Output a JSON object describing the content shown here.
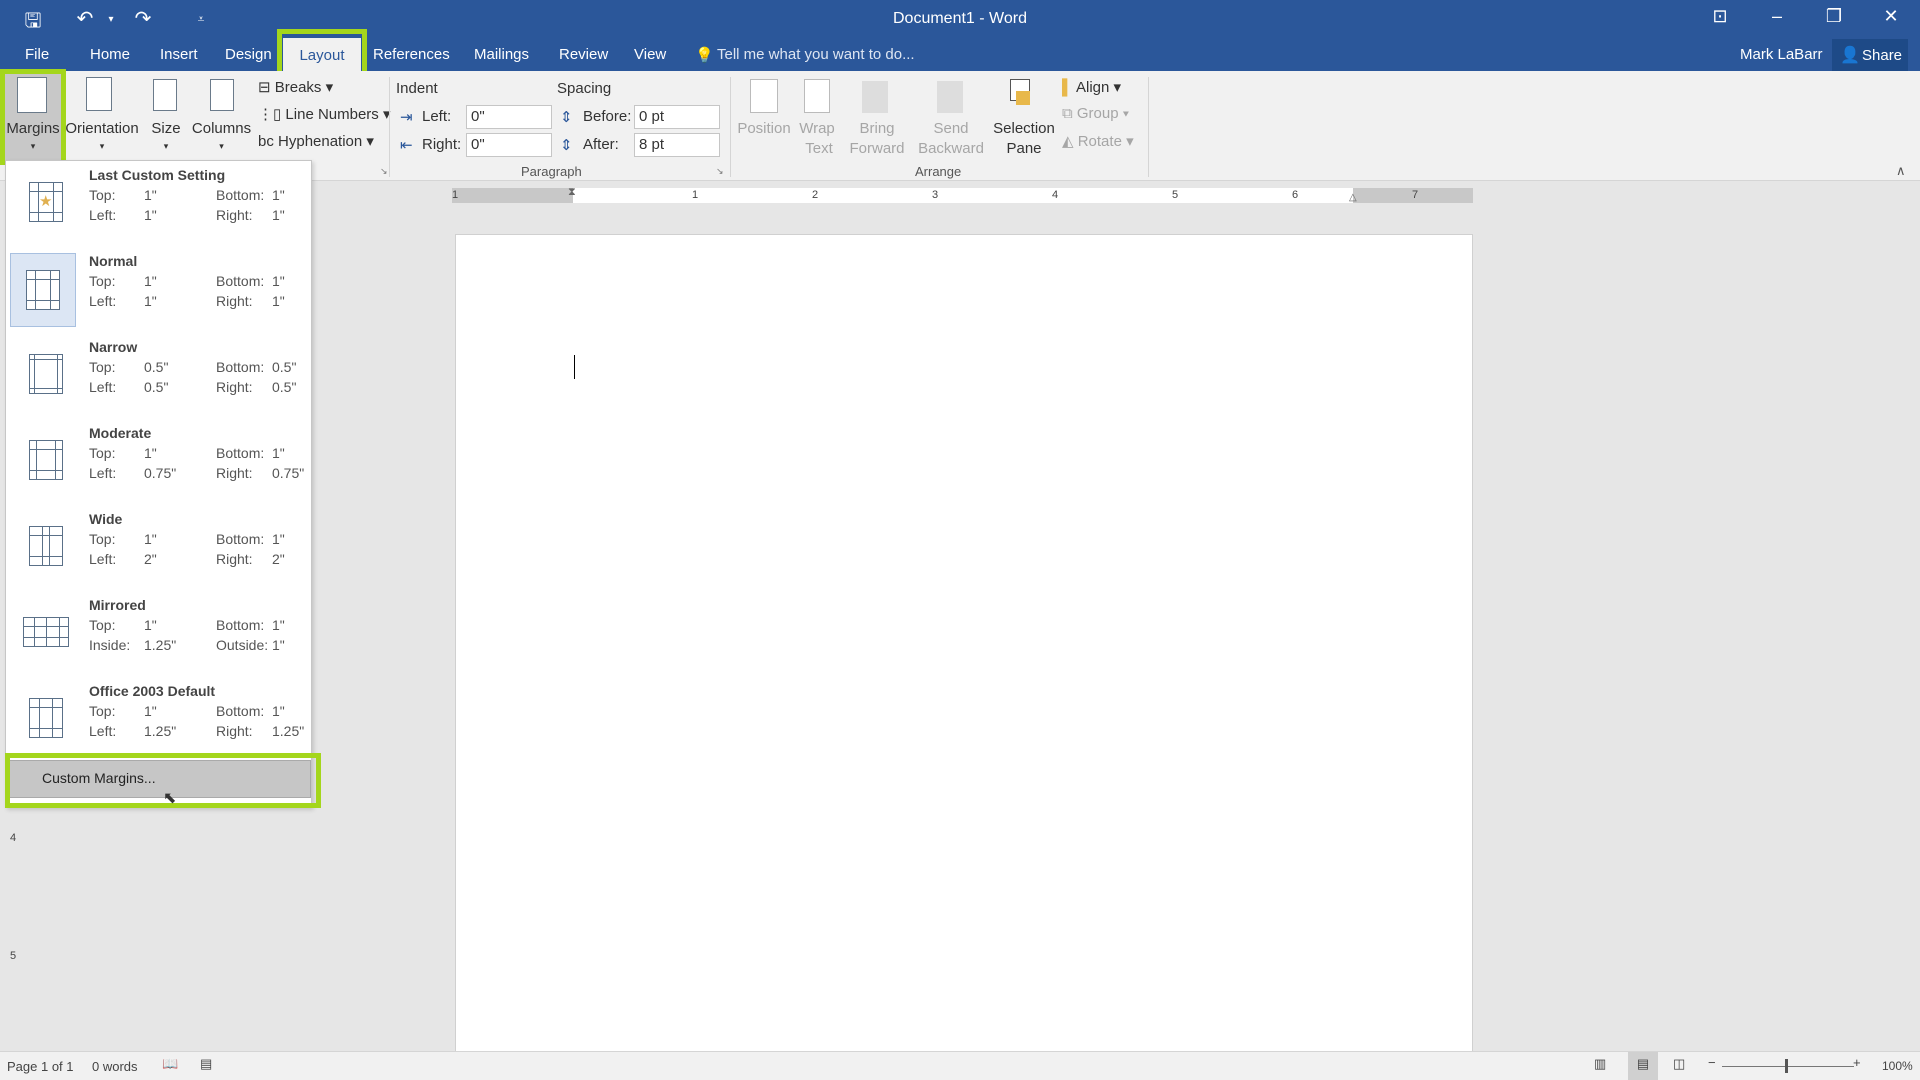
{
  "window": {
    "title": "Document1 - Word",
    "user": "Mark LaBarr",
    "share": "Share"
  },
  "tabs": [
    "File",
    "Home",
    "Insert",
    "Design",
    "Layout",
    "References",
    "Mailings",
    "Review",
    "View"
  ],
  "tell_me": "Tell me what you want to do...",
  "ribbon": {
    "page_setup": {
      "margins": "Margins",
      "orientation": "Orientation",
      "size": "Size",
      "columns": "Columns",
      "breaks": "Breaks",
      "line_numbers": "Line Numbers",
      "hyphenation": "Hyphenation"
    },
    "paragraph": {
      "indent": "Indent",
      "spacing": "Spacing",
      "left_label": "Left:",
      "right_label": "Right:",
      "before_label": "Before:",
      "after_label": "After:",
      "left": "0\"",
      "right": "0\"",
      "before": "0 pt",
      "after": "8 pt",
      "group": "Paragraph"
    },
    "arrange": {
      "position": "Position",
      "wrap1": "Wrap",
      "wrap2": "Text",
      "bring1": "Bring",
      "bring2": "Forward",
      "send1": "Send",
      "send2": "Backward",
      "sel1": "Selection",
      "sel2": "Pane",
      "align": "Align",
      "group_btn": "Group",
      "rotate": "Rotate",
      "group": "Arrange"
    }
  },
  "ruler": {
    "labels": [
      "1",
      "1",
      "2",
      "3",
      "4",
      "5",
      "6",
      "7"
    ]
  },
  "vruler": {
    "labels": [
      "4",
      "5"
    ]
  },
  "margins_menu": [
    {
      "name": "Last Custom Setting",
      "l1": "Top:",
      "v1": "1\"",
      "l2": "Bottom:",
      "v2": "1\"",
      "l3": "Left:",
      "v3": "1\"",
      "l4": "Right:",
      "v4": "1\""
    },
    {
      "name": "Normal",
      "l1": "Top:",
      "v1": "1\"",
      "l2": "Bottom:",
      "v2": "1\"",
      "l3": "Left:",
      "v3": "1\"",
      "l4": "Right:",
      "v4": "1\""
    },
    {
      "name": "Narrow",
      "l1": "Top:",
      "v1": "0.5\"",
      "l2": "Bottom:",
      "v2": "0.5\"",
      "l3": "Left:",
      "v3": "0.5\"",
      "l4": "Right:",
      "v4": "0.5\""
    },
    {
      "name": "Moderate",
      "l1": "Top:",
      "v1": "1\"",
      "l2": "Bottom:",
      "v2": "1\"",
      "l3": "Left:",
      "v3": "0.75\"",
      "l4": "Right:",
      "v4": "0.75\""
    },
    {
      "name": "Wide",
      "l1": "Top:",
      "v1": "1\"",
      "l2": "Bottom:",
      "v2": "1\"",
      "l3": "Left:",
      "v3": "2\"",
      "l4": "Right:",
      "v4": "2\""
    },
    {
      "name": "Mirrored",
      "l1": "Top:",
      "v1": "1\"",
      "l2": "Bottom:",
      "v2": "1\"",
      "l3": "Inside:",
      "v3": "1.25\"",
      "l4": "Outside:",
      "v4": "1\""
    },
    {
      "name": "Office 2003 Default",
      "l1": "Top:",
      "v1": "1\"",
      "l2": "Bottom:",
      "v2": "1\"",
      "l3": "Left:",
      "v3": "1.25\"",
      "l4": "Right:",
      "v4": "1.25\""
    }
  ],
  "custom_margins": "Custom Margins...",
  "status": {
    "page": "Page 1 of 1",
    "words": "0 words",
    "zoom": "100%"
  },
  "colors": {
    "brand": "#2b579a",
    "highlight": "#a4d61c"
  }
}
